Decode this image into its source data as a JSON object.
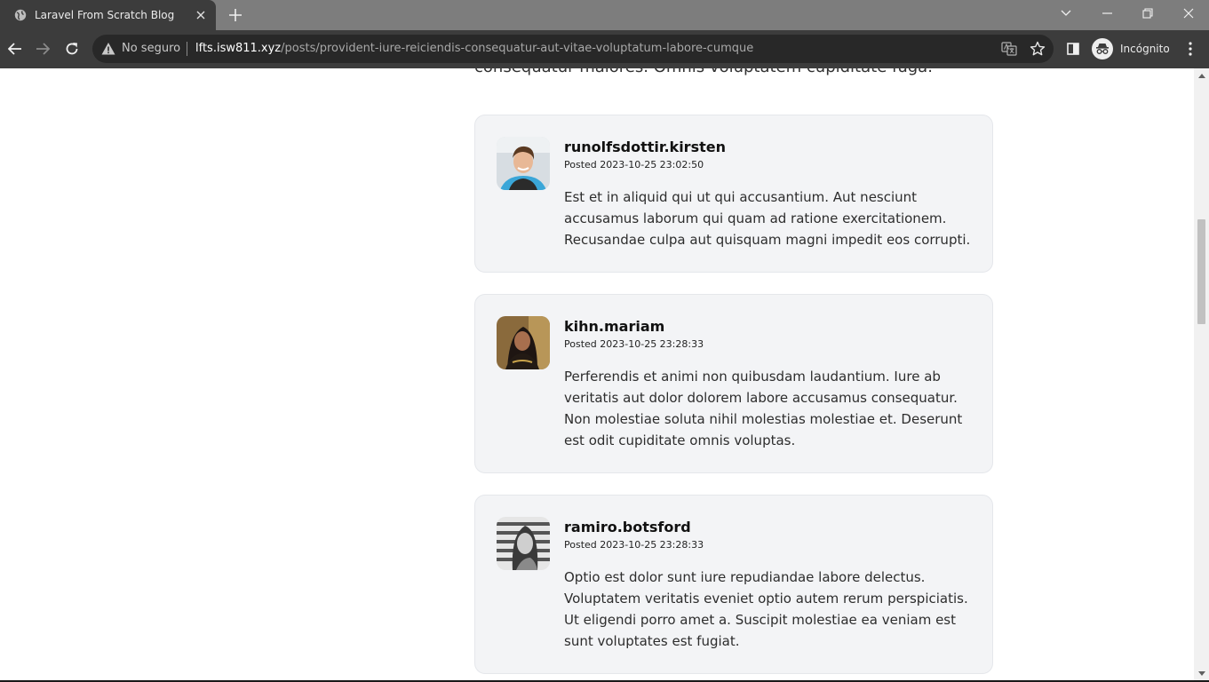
{
  "browser": {
    "tab_title": "Laravel From Scratch Blog",
    "security_label": "No seguro",
    "url_host": "lfts.isw811.xyz",
    "url_path": "/posts/provident-iure-reiciendis-consequatur-aut-vitae-voluptatum-labore-cumque",
    "profile_label": "Incógnito"
  },
  "post": {
    "intro_tail": "consequatur maiores. Omnis voluptatem cupiditate fuga."
  },
  "comments": [
    {
      "author": "runolfsdottir.kirsten",
      "posted": "Posted 2023-10-25 23:02:50",
      "body": "Est et in aliquid qui ut qui accusantium. Aut nesciunt accusamus laborum qui quam ad ratione exercitationem. Recusandae culpa aut quisquam magni impedit eos corrupti."
    },
    {
      "author": "kihn.mariam",
      "posted": "Posted 2023-10-25 23:28:33",
      "body": "Perferendis et animi non quibusdam laudantium. Iure ab veritatis aut dolor dolorem labore accusamus consequatur. Non molestiae soluta nihil molestias molestiae et. Deserunt est odit cupiditate omnis voluptas."
    },
    {
      "author": "ramiro.botsford",
      "posted": "Posted 2023-10-25 23:28:33",
      "body": "Optio est dolor sunt iure repudiandae labore delectus. Voluptatem veritatis eveniet optio autem rerum perspiciatis. Ut eligendi porro amet a. Suscipit molestiae ea veniam est sunt voluptates est fugiat."
    }
  ],
  "colors": {
    "card_bg": "#f3f4f6",
    "card_border": "#e5e7eb",
    "chrome_dark": "#3c3c3c"
  }
}
